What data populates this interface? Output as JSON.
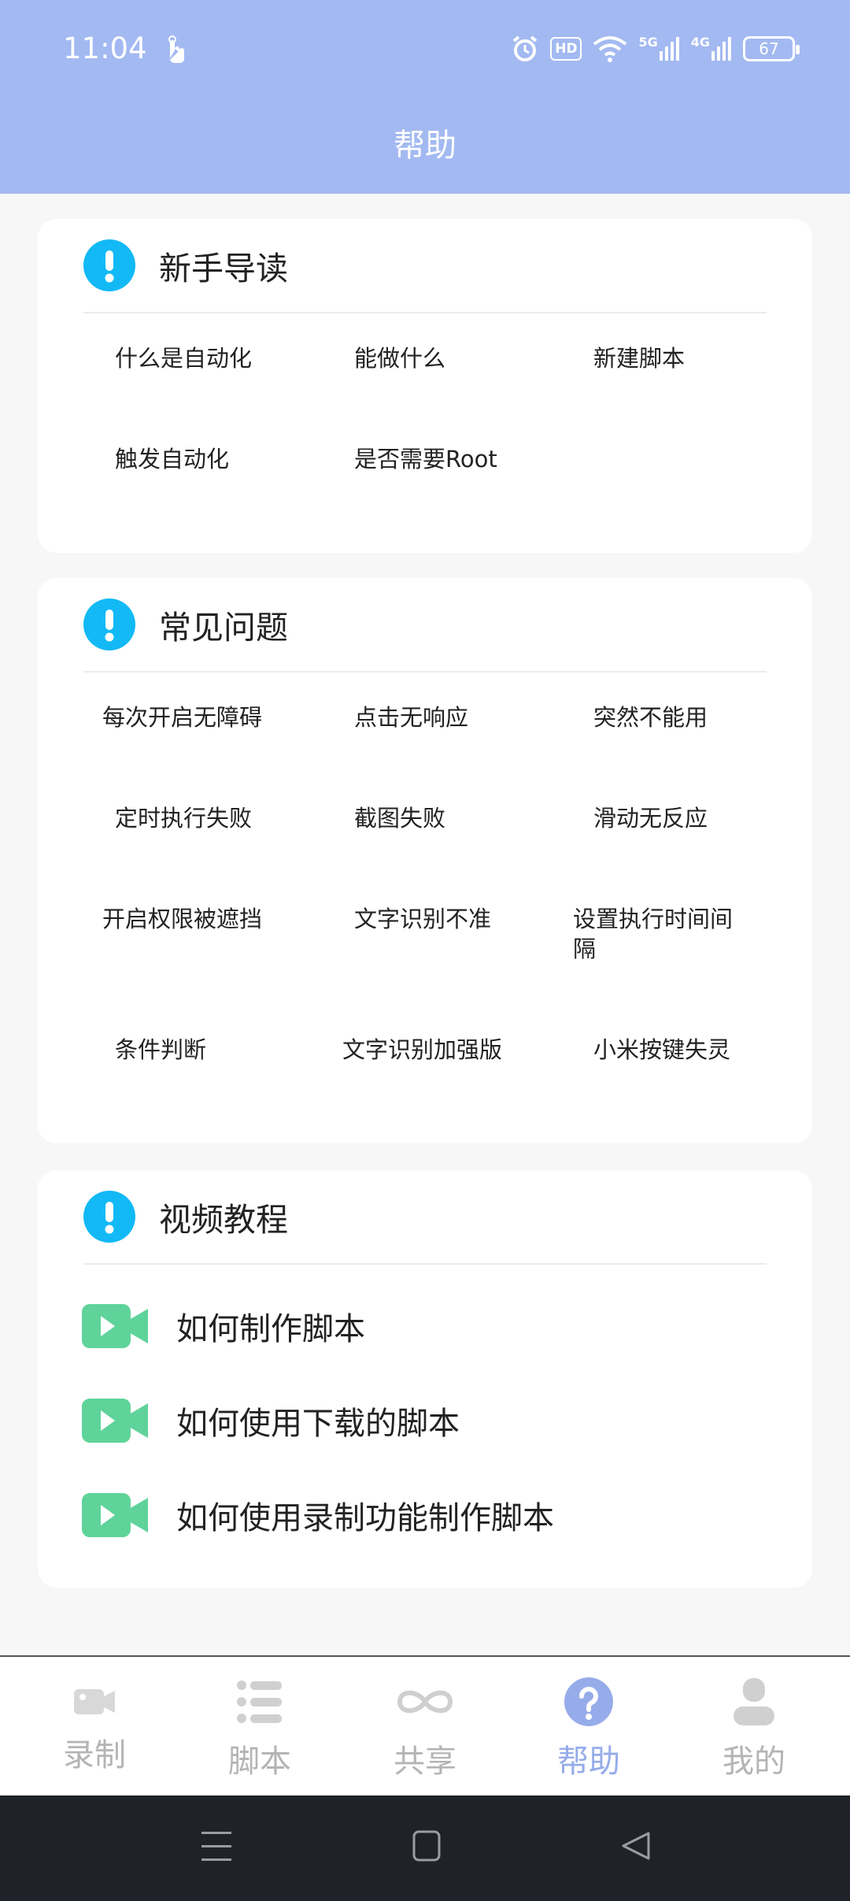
{
  "status_bar": {
    "time": "11:04",
    "hd_label": "HD",
    "net_5g": "5G",
    "net_4g": "4G",
    "battery": "67"
  },
  "header": {
    "title": "帮助"
  },
  "sections": {
    "beginner": {
      "title": "新手导读",
      "items": [
        "什么是自动化",
        "能做什么",
        "新建脚本",
        "触发自动化",
        "是否需要Root"
      ]
    },
    "faq": {
      "title": "常见问题",
      "items": [
        "每次开启无障碍",
        "点击无响应",
        "突然不能用",
        "定时执行失败",
        "截图失败",
        "滑动无反应",
        "开启权限被遮挡",
        "文字识别不准",
        "设置执行时间间隔",
        "条件判断",
        "文字识别加强版",
        "小米按键失灵"
      ]
    },
    "videos": {
      "title": "视频教程",
      "items": [
        "如何制作脚本",
        "如何使用下载的脚本",
        "如何使用录制功能制作脚本"
      ]
    }
  },
  "bottom_nav": {
    "items": [
      {
        "label": "录制",
        "icon": "camera-icon"
      },
      {
        "label": "脚本",
        "icon": "list-icon"
      },
      {
        "label": "共享",
        "icon": "infinity-icon"
      },
      {
        "label": "帮助",
        "icon": "question-icon"
      },
      {
        "label": "我的",
        "icon": "profile-icon"
      }
    ],
    "active_index": 3
  },
  "colors": {
    "header_bg": "#a3b9f1",
    "accent": "#96acea",
    "alert_icon": "#12b9f5",
    "video_icon": "#5fd39a",
    "inactive_nav": "#b4b4b4"
  }
}
